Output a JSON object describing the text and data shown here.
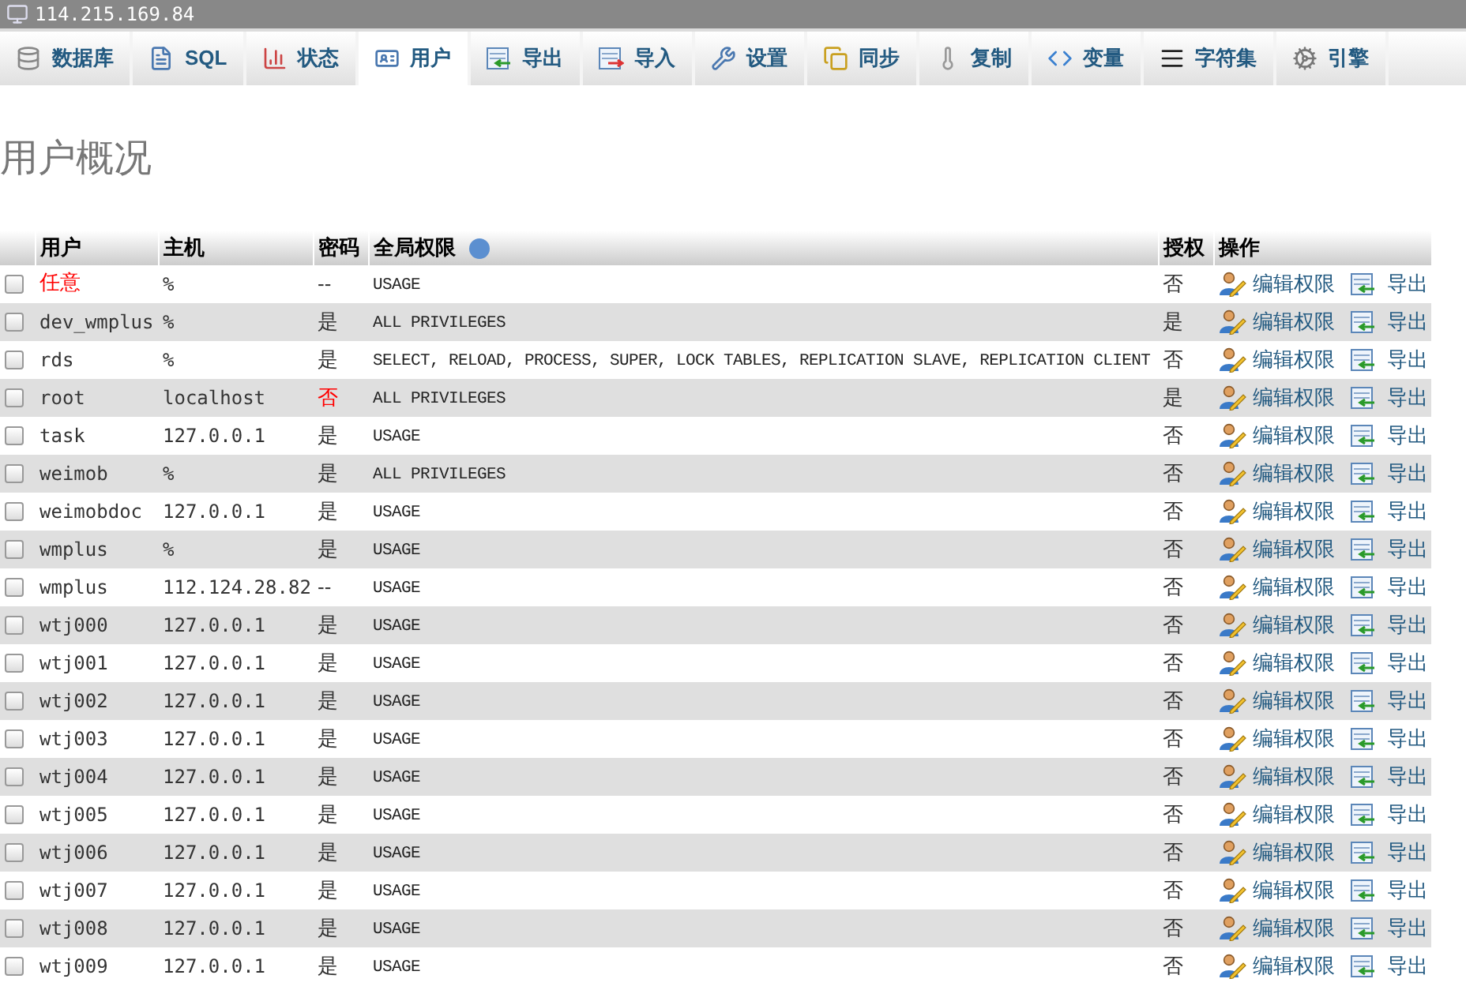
{
  "window": {
    "title": "114.215.169.84"
  },
  "tabs": [
    {
      "label": "数据库",
      "kind": "database",
      "selected": false
    },
    {
      "label": "SQL",
      "kind": "sql",
      "selected": false
    },
    {
      "label": "状态",
      "kind": "status",
      "selected": false
    },
    {
      "label": "用户",
      "kind": "users",
      "selected": true
    },
    {
      "label": "导出",
      "kind": "export",
      "selected": false
    },
    {
      "label": "导入",
      "kind": "import",
      "selected": false
    },
    {
      "label": "设置",
      "kind": "settings",
      "selected": false
    },
    {
      "label": "同步",
      "kind": "sync",
      "selected": false
    },
    {
      "label": "复制",
      "kind": "replication",
      "selected": false
    },
    {
      "label": "变量",
      "kind": "variables",
      "selected": false
    },
    {
      "label": "字符集",
      "kind": "charset",
      "selected": false
    },
    {
      "label": "引擎",
      "kind": "engines",
      "selected": false
    }
  ],
  "heading": "用户概况",
  "table": {
    "columns": [
      "用户",
      "主机",
      "密码",
      "全局权限",
      "授权",
      "操作"
    ],
    "rows": [
      {
        "checked": false,
        "user": "任意",
        "user_alert": true,
        "host": "%",
        "password": "--",
        "password_alert": false,
        "privileges": "USAGE",
        "grant": "否",
        "edit": "编辑权限",
        "export": "导出"
      },
      {
        "checked": false,
        "user": "dev_wmplus",
        "user_alert": false,
        "host": "%",
        "password": "是",
        "password_alert": false,
        "privileges": "ALL PRIVILEGES",
        "grant": "是",
        "edit": "编辑权限",
        "export": "导出"
      },
      {
        "checked": false,
        "user": "rds",
        "user_alert": false,
        "host": "%",
        "password": "是",
        "password_alert": false,
        "privileges": "SELECT, RELOAD, PROCESS, SUPER, LOCK TABLES, REPLICATION SLAVE, REPLICATION CLIENT",
        "grant": "否",
        "edit": "编辑权限",
        "export": "导出"
      },
      {
        "checked": false,
        "user": "root",
        "user_alert": false,
        "host": "localhost",
        "password": "否",
        "password_alert": true,
        "privileges": "ALL PRIVILEGES",
        "grant": "是",
        "edit": "编辑权限",
        "export": "导出"
      },
      {
        "checked": false,
        "user": "task",
        "user_alert": false,
        "host": "127.0.0.1",
        "password": "是",
        "password_alert": false,
        "privileges": "USAGE",
        "grant": "否",
        "edit": "编辑权限",
        "export": "导出"
      },
      {
        "checked": false,
        "user": "weimob",
        "user_alert": false,
        "host": "%",
        "password": "是",
        "password_alert": false,
        "privileges": "ALL PRIVILEGES",
        "grant": "否",
        "edit": "编辑权限",
        "export": "导出"
      },
      {
        "checked": false,
        "user": "weimobdoc",
        "user_alert": false,
        "host": "127.0.0.1",
        "password": "是",
        "password_alert": false,
        "privileges": "USAGE",
        "grant": "否",
        "edit": "编辑权限",
        "export": "导出"
      },
      {
        "checked": false,
        "user": "wmplus",
        "user_alert": false,
        "host": "%",
        "password": "是",
        "password_alert": false,
        "privileges": "USAGE",
        "grant": "否",
        "edit": "编辑权限",
        "export": "导出"
      },
      {
        "checked": false,
        "user": "wmplus",
        "user_alert": false,
        "host": "112.124.28.82",
        "password": "--",
        "password_alert": false,
        "privileges": "USAGE",
        "grant": "否",
        "edit": "编辑权限",
        "export": "导出"
      },
      {
        "checked": false,
        "user": "wtj000",
        "user_alert": false,
        "host": "127.0.0.1",
        "password": "是",
        "password_alert": false,
        "privileges": "USAGE",
        "grant": "否",
        "edit": "编辑权限",
        "export": "导出"
      },
      {
        "checked": false,
        "user": "wtj001",
        "user_alert": false,
        "host": "127.0.0.1",
        "password": "是",
        "password_alert": false,
        "privileges": "USAGE",
        "grant": "否",
        "edit": "编辑权限",
        "export": "导出"
      },
      {
        "checked": false,
        "user": "wtj002",
        "user_alert": false,
        "host": "127.0.0.1",
        "password": "是",
        "password_alert": false,
        "privileges": "USAGE",
        "grant": "否",
        "edit": "编辑权限",
        "export": "导出"
      },
      {
        "checked": false,
        "user": "wtj003",
        "user_alert": false,
        "host": "127.0.0.1",
        "password": "是",
        "password_alert": false,
        "privileges": "USAGE",
        "grant": "否",
        "edit": "编辑权限",
        "export": "导出"
      },
      {
        "checked": false,
        "user": "wtj004",
        "user_alert": false,
        "host": "127.0.0.1",
        "password": "是",
        "password_alert": false,
        "privileges": "USAGE",
        "grant": "否",
        "edit": "编辑权限",
        "export": "导出"
      },
      {
        "checked": false,
        "user": "wtj005",
        "user_alert": false,
        "host": "127.0.0.1",
        "password": "是",
        "password_alert": false,
        "privileges": "USAGE",
        "grant": "否",
        "edit": "编辑权限",
        "export": "导出"
      },
      {
        "checked": false,
        "user": "wtj006",
        "user_alert": false,
        "host": "127.0.0.1",
        "password": "是",
        "password_alert": false,
        "privileges": "USAGE",
        "grant": "否",
        "edit": "编辑权限",
        "export": "导出"
      },
      {
        "checked": false,
        "user": "wtj007",
        "user_alert": false,
        "host": "127.0.0.1",
        "password": "是",
        "password_alert": false,
        "privileges": "USAGE",
        "grant": "否",
        "edit": "编辑权限",
        "export": "导出"
      },
      {
        "checked": false,
        "user": "wtj008",
        "user_alert": false,
        "host": "127.0.0.1",
        "password": "是",
        "password_alert": false,
        "privileges": "USAGE",
        "grant": "否",
        "edit": "编辑权限",
        "export": "导出"
      },
      {
        "checked": false,
        "user": "wtj009",
        "user_alert": false,
        "host": "127.0.0.1",
        "password": "是",
        "password_alert": false,
        "privileges": "USAGE",
        "grant": "否",
        "edit": "编辑权限",
        "export": "导出"
      }
    ]
  }
}
